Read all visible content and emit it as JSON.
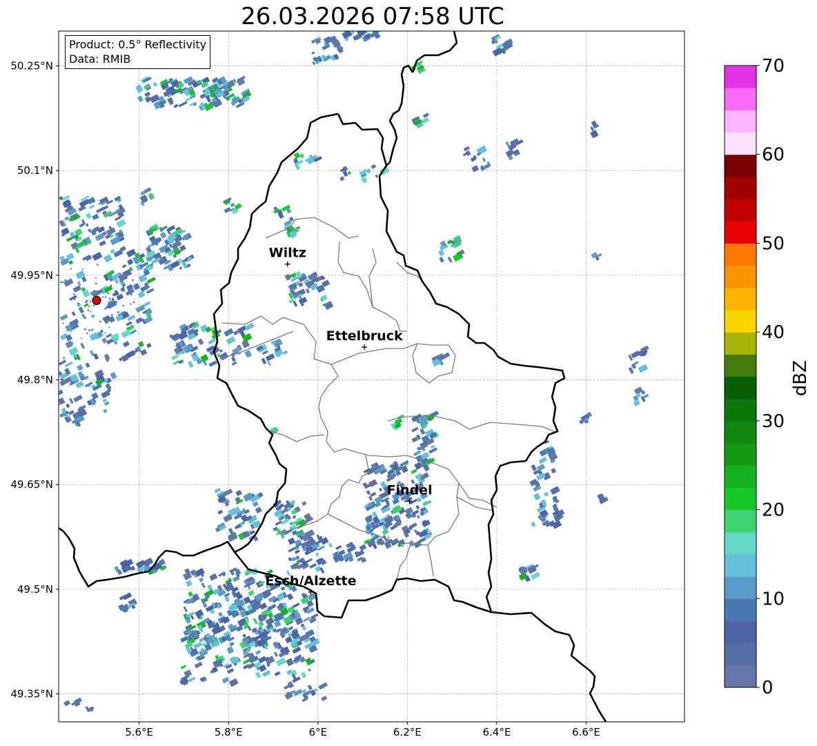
{
  "title": "26.03.2026 07:58 UTC",
  "info": {
    "product": "Product: 0.5° Reflectivity",
    "data": "Data: RMIB"
  },
  "map": {
    "lon_range": [
      5.42,
      6.82
    ],
    "lat_range": [
      49.31,
      50.3
    ],
    "x_ticks": [
      {
        "value": 5.6,
        "label": "5.6°E"
      },
      {
        "value": 5.8,
        "label": "5.8°E"
      },
      {
        "value": 6.0,
        "label": "6°E"
      },
      {
        "value": 6.2,
        "label": "6.2°E"
      },
      {
        "value": 6.4,
        "label": "6.4°E"
      },
      {
        "value": 6.6,
        "label": "6.6°E"
      }
    ],
    "y_ticks": [
      {
        "value": 49.35,
        "label": "49.35°N"
      },
      {
        "value": 49.5,
        "label": "49.5°N"
      },
      {
        "value": 49.65,
        "label": "49.65°N"
      },
      {
        "value": 49.8,
        "label": "49.8°N"
      },
      {
        "value": 49.95,
        "label": "49.95°N"
      },
      {
        "value": 50.1,
        "label": "50.1°N"
      },
      {
        "value": 50.25,
        "label": "50.25°N"
      }
    ],
    "grid": true,
    "radar_site": {
      "lon": 5.505,
      "lat": 49.914,
      "color": "#e00000"
    },
    "cities": [
      {
        "name": "Wiltz",
        "lon": 5.932,
        "lat": 49.966
      },
      {
        "name": "Ettelbruck",
        "lon": 6.104,
        "lat": 49.847
      },
      {
        "name": "Findel",
        "lon": 6.205,
        "lat": 49.626
      },
      {
        "name": "Esch/Alzette",
        "lon": 5.984,
        "lat": 49.496
      }
    ]
  },
  "colorbar": {
    "label": "dBZ",
    "min": 0,
    "max": 70,
    "ticks": [
      {
        "value": 0,
        "label": "0"
      },
      {
        "value": 10,
        "label": "10"
      },
      {
        "value": 20,
        "label": "20"
      },
      {
        "value": 30,
        "label": "30"
      },
      {
        "value": 40,
        "label": "40"
      },
      {
        "value": 50,
        "label": "50"
      },
      {
        "value": 60,
        "label": "60"
      },
      {
        "value": 70,
        "label": "70"
      }
    ],
    "colors": [
      "#6478a8",
      "#5a6ea6",
      "#4a64a8",
      "#4a78b2",
      "#5a9cc8",
      "#64c0dc",
      "#64d8c8",
      "#3cd470",
      "#14c828",
      "#14b41e",
      "#149a14",
      "#108810",
      "#0a780a",
      "#065e06",
      "#467a0a",
      "#aab208",
      "#fcd600",
      "#fcb400",
      "#fc9600",
      "#fc7800",
      "#e60000",
      "#c00000",
      "#a00000",
      "#780000",
      "#fce2fc",
      "#fcb4fc",
      "#fc6cfc",
      "#e632e6"
    ]
  }
}
